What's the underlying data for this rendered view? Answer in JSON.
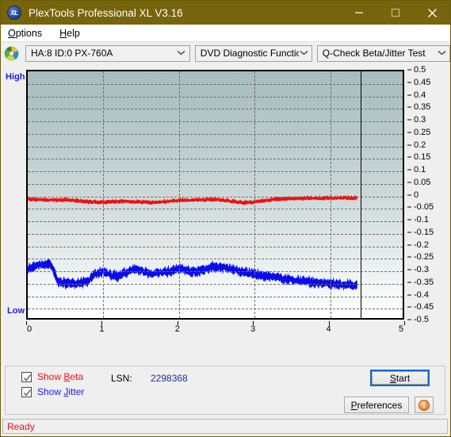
{
  "window": {
    "title": "PlexTools Professional XL V3.16",
    "app_icon": "xl-logo-icon",
    "minimize_label": "Minimize",
    "maximize_label": "Maximize",
    "close_label": "Close",
    "titlebar_color": "#77640c"
  },
  "menu": {
    "items": [
      {
        "label": "Options",
        "accel": "O"
      },
      {
        "label": "Help",
        "accel": "H"
      }
    ]
  },
  "toolbar": {
    "drive_icon": "optical-disc-icon",
    "drive_select": {
      "value": "HA:8 ID:0  PX-760A",
      "options": [
        "HA:8 ID:0  PX-760A"
      ]
    },
    "function_select": {
      "value": "DVD Diagnostic Functions",
      "options": [
        "DVD Diagnostic Functions"
      ]
    },
    "test_select": {
      "value": "Q-Check Beta/Jitter Test",
      "options": [
        "Q-Check Beta/Jitter Test"
      ]
    }
  },
  "chart_labels": {
    "high": "High",
    "low": "Low"
  },
  "controls": {
    "show_beta": {
      "label_prefix": "Show ",
      "label_accel": "B",
      "label_suffix": "eta",
      "checked": true,
      "color": "#f20f0f"
    },
    "show_jitter": {
      "label_prefix": "Show ",
      "label_accel": "J",
      "label_suffix": "itter",
      "checked": true,
      "color": "#1a1af0"
    },
    "lsn_label": "LSN:",
    "lsn_value": "2298368",
    "start_button": {
      "prefix": "",
      "accel": "S",
      "suffix": "tart"
    },
    "preferences_button": {
      "prefix": "",
      "accel": "P",
      "suffix": "references"
    },
    "info_button": {
      "icon": "info-icon",
      "glyph": "i"
    }
  },
  "status": {
    "text": "Ready",
    "color": "#f20f0f"
  },
  "chart_data": {
    "type": "line",
    "title": "Q-Check Beta/Jitter Test",
    "xlabel": "",
    "ylabel": "",
    "xlim": [
      0,
      5
    ],
    "ylim": [
      -0.5,
      0.5
    ],
    "xticks": [
      0,
      1,
      2,
      3,
      4,
      5
    ],
    "yticks": [
      0.5,
      0.45,
      0.4,
      0.35,
      0.3,
      0.25,
      0.2,
      0.15,
      0.1,
      0.05,
      0,
      -0.05,
      -0.1,
      -0.15,
      -0.2,
      -0.25,
      -0.3,
      -0.35,
      -0.4,
      -0.45,
      -0.5
    ],
    "grid": true,
    "legend_position": "bottom-left-checkboxes",
    "data_end_x": 4.4,
    "series": [
      {
        "name": "Beta",
        "color": "#f20f0f",
        "x": [
          0.0,
          0.1,
          0.2,
          0.3,
          0.4,
          0.5,
          0.6,
          0.7,
          0.8,
          0.9,
          1.0,
          1.1,
          1.2,
          1.3,
          1.4,
          1.5,
          1.6,
          1.7,
          1.8,
          1.9,
          2.0,
          2.1,
          2.2,
          2.3,
          2.4,
          2.5,
          2.6,
          2.7,
          2.8,
          2.9,
          3.0,
          3.1,
          3.2,
          3.3,
          3.4,
          3.5,
          3.6,
          3.7,
          3.8,
          3.9,
          4.0,
          4.1,
          4.2,
          4.3,
          4.4
        ],
        "values": [
          -0.018,
          -0.019,
          -0.02,
          -0.021,
          -0.021,
          -0.022,
          -0.023,
          -0.026,
          -0.029,
          -0.03,
          -0.031,
          -0.029,
          -0.027,
          -0.026,
          -0.028,
          -0.029,
          -0.031,
          -0.03,
          -0.028,
          -0.026,
          -0.024,
          -0.022,
          -0.021,
          -0.02,
          -0.02,
          -0.019,
          -0.022,
          -0.026,
          -0.03,
          -0.032,
          -0.03,
          -0.026,
          -0.022,
          -0.019,
          -0.017,
          -0.016,
          -0.015,
          -0.014,
          -0.014,
          -0.014,
          -0.013,
          -0.013,
          -0.013,
          -0.013,
          -0.013
        ],
        "noise_amplitude": 0.012
      },
      {
        "name": "Jitter",
        "color": "#0b0bf0",
        "x": [
          0.0,
          0.1,
          0.2,
          0.3,
          0.4,
          0.5,
          0.6,
          0.7,
          0.8,
          0.9,
          1.0,
          1.1,
          1.2,
          1.3,
          1.4,
          1.5,
          1.6,
          1.7,
          1.8,
          1.9,
          2.0,
          2.1,
          2.2,
          2.3,
          2.4,
          2.5,
          2.6,
          2.7,
          2.8,
          2.9,
          3.0,
          3.1,
          3.2,
          3.3,
          3.4,
          3.5,
          3.6,
          3.7,
          3.8,
          3.9,
          4.0,
          4.1,
          4.2,
          4.3,
          4.4
        ],
        "values": [
          -0.3,
          -0.291,
          -0.283,
          -0.276,
          -0.352,
          -0.358,
          -0.359,
          -0.356,
          -0.35,
          -0.32,
          -0.312,
          -0.325,
          -0.33,
          -0.318,
          -0.3,
          -0.308,
          -0.318,
          -0.32,
          -0.314,
          -0.308,
          -0.3,
          -0.305,
          -0.312,
          -0.308,
          -0.298,
          -0.29,
          -0.294,
          -0.3,
          -0.308,
          -0.316,
          -0.322,
          -0.326,
          -0.33,
          -0.334,
          -0.34,
          -0.344,
          -0.348,
          -0.352,
          -0.356,
          -0.358,
          -0.36,
          -0.362,
          -0.364,
          -0.365,
          -0.366
        ],
        "noise_amplitude": 0.03
      }
    ]
  }
}
